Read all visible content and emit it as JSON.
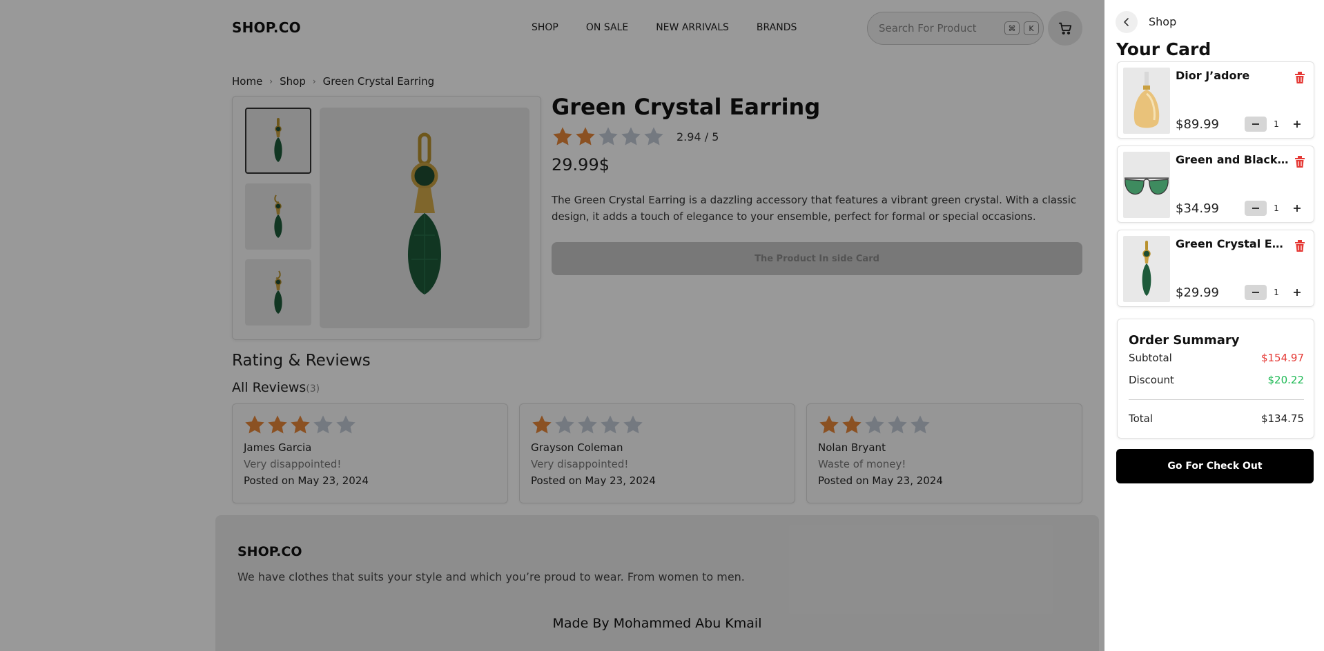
{
  "header": {
    "logo": "SHOP.CO",
    "nav": [
      "SHOP",
      "ON SALE",
      "NEW ARRIVALS",
      "BRANDS"
    ],
    "search_placeholder": "Search For Product",
    "shortcut_keys": [
      "⌘",
      "K"
    ]
  },
  "breadcrumb": [
    "Home",
    "Shop",
    "Green Crystal Earring"
  ],
  "product": {
    "title": "Green Crystal Earring",
    "rating": 2.94,
    "rating_text": "2.94 / 5",
    "price": "29.99$",
    "description": "The Green Crystal Earring is a dazzling accessory that features a vibrant green crystal. With a classic design, it adds a touch of elegance to your ensemble, perfect for formal or special occasions.",
    "button_label": "The Product In side Card"
  },
  "reviews": {
    "heading": "Rating & Reviews",
    "all_label": "All Reviews",
    "count": "(3)",
    "items": [
      {
        "stars": 3,
        "name": "James Garcia",
        "comment": "Very disappointed!",
        "posted": "Posted on May 23, 2024"
      },
      {
        "stars": 1,
        "name": "Grayson Coleman",
        "comment": "Very disappointed!",
        "posted": "Posted on May 23, 2024"
      },
      {
        "stars": 2,
        "name": "Nolan Bryant",
        "comment": "Waste of money!",
        "posted": "Posted on May 23, 2024"
      }
    ]
  },
  "footer": {
    "logo": "SHOP.CO",
    "text": "We have clothes that suits your style and which you’re proud to wear. From women to men.",
    "made_by": "Made By Mohammed Abu Kmail"
  },
  "cart": {
    "back_label": "Shop",
    "title": "Your Card",
    "items": [
      {
        "name": "Dior J’adore",
        "price": "$89.99",
        "qty": "1"
      },
      {
        "name": "Green and Black Glasses",
        "price": "$34.99",
        "qty": "1"
      },
      {
        "name": "Green Crystal Earring",
        "price": "$29.99",
        "qty": "1"
      }
    ],
    "summary": {
      "title": "Order Summary",
      "subtotal_label": "Subtotal",
      "subtotal": "$154.97",
      "discount_label": "Discount",
      "discount": "$20.22",
      "total_label": "Total",
      "total": "$134.75"
    },
    "checkout_label": "Go For Check Out"
  },
  "colors": {
    "star_filled": "#e8873a",
    "star_empty": "#c2cad6",
    "price_red": "#e53935",
    "discount_green": "#1db954",
    "trash_red": "#e53935",
    "overlay": "rgba(0,0,0,0.40)"
  }
}
